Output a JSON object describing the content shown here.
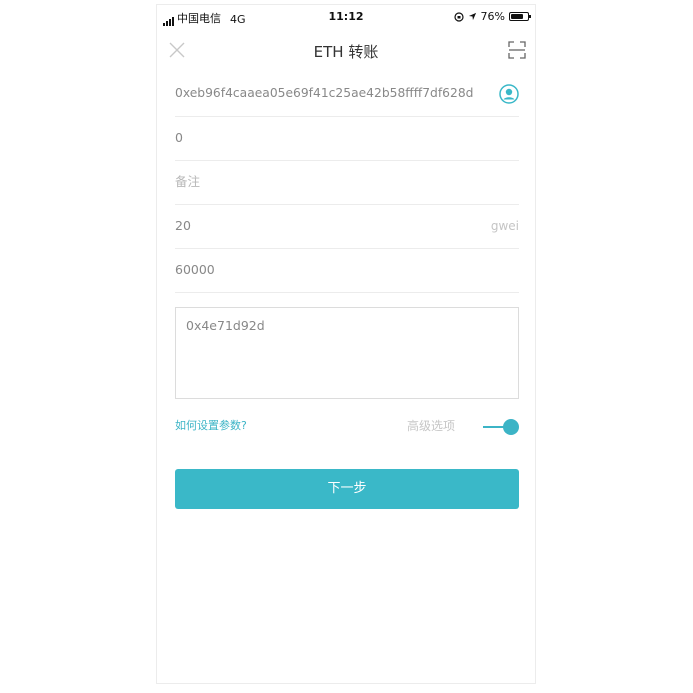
{
  "status_bar": {
    "carrier": "中国电信",
    "network": "4G",
    "time": "11:12",
    "battery_text": "76%",
    "battery_level": 0.76
  },
  "nav": {
    "title": "ETH 转账",
    "close_icon": "close-icon",
    "scan_icon": "scan-icon"
  },
  "form": {
    "address": {
      "value": "0xeb96f4caaea05e69f41c25ae42b58ffff7df628d",
      "contact_icon": "contact-icon"
    },
    "amount": {
      "value": "0"
    },
    "memo": {
      "value": "",
      "placeholder": "备注"
    },
    "gas_price": {
      "value": "20",
      "unit": "gwei"
    },
    "gas_limit": {
      "value": "60000"
    },
    "data": {
      "value": "0x4e71d92d"
    }
  },
  "options": {
    "help_link": "如何设置参数?",
    "advanced_label": "高级选项",
    "advanced_enabled": true
  },
  "next_button": "下一步",
  "colors": {
    "accent": "#3ab8c8"
  }
}
